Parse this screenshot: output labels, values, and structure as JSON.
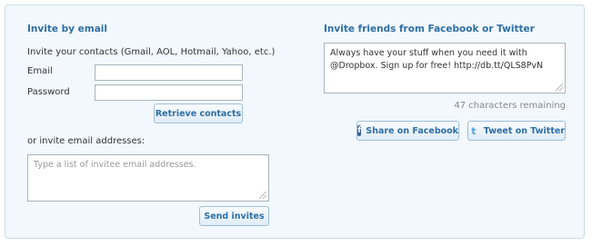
{
  "email_section": {
    "title": "Invite by email",
    "contacts_intro": "Invite your contacts (Gmail, AOL, Hotmail, Yahoo, etc.)",
    "email_label": "Email",
    "email_value": "",
    "password_label": "Password",
    "password_value": "",
    "retrieve_button": "Retrieve contacts",
    "or_invite_label": "or invite email addresses:",
    "addresses_placeholder": "Type a list of invitee email addresses.",
    "send_button": "Send invites"
  },
  "social_section": {
    "title": "Invite friends from Facebook or Twitter",
    "message": "Always have your stuff when you need it with @Dropbox. Sign up for free! http://db.tt/QLS8PvN",
    "chars_remaining": "47 characters remaining",
    "facebook_button": "Share on Facebook",
    "twitter_button": "Tweet on Twitter",
    "facebook_icon": "facebook-icon",
    "twitter_icon": "twitter-icon"
  },
  "colors": {
    "panel_bg": "#f2f8fd",
    "accent": "#2f6fa5",
    "facebook": "#3b5998",
    "twitter": "#4aa3df"
  }
}
